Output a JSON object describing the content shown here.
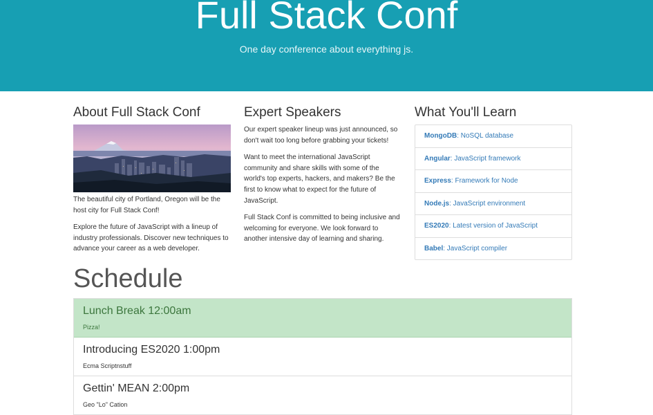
{
  "hero": {
    "title": "Full Stack Conf",
    "subtitle": "One day conference about everything js."
  },
  "about": {
    "heading": "About Full Stack Conf",
    "image_caption": "The beautiful city of Portland, Oregon will be the host city for Full Stack Conf!",
    "paragraph": "Explore the future of JavaScript with a lineup of industry professionals. Discover new techniques to advance your career as a web developer."
  },
  "speakers": {
    "heading": "Expert Speakers",
    "paragraphs": [
      "Our expert speaker lineup was just announced, so don't wait too long before grabbing your tickets!",
      "Want to meet the international JavaScript community and share skills with some of the world's top experts, hackers, and makers? Be the first to know what to expect for the future of JavaScript.",
      "Full Stack Conf is committed to being inclusive and welcoming for everyone. We look forward to another intensive day of learning and sharing."
    ]
  },
  "learn": {
    "heading": "What You'll Learn",
    "items": [
      {
        "name": "MongoDB",
        "desc": ": NoSQL database"
      },
      {
        "name": "Angular",
        "desc": ": JavaScript framework"
      },
      {
        "name": "Express",
        "desc": ": Framework for Node"
      },
      {
        "name": "Node.js",
        "desc": ": JavaScript environment"
      },
      {
        "name": "ES2020",
        "desc": ": Latest version of JavaScript"
      },
      {
        "name": "Babel",
        "desc": ": JavaScript compiler"
      }
    ]
  },
  "schedule": {
    "heading": "Schedule",
    "items": [
      {
        "title": "Lunch Break 12:00am",
        "desc": "Pizza!"
      },
      {
        "title": "Introducing ES2020 1:00pm",
        "desc": "Ecma Scriptnstuff"
      },
      {
        "title": "Gettin' MEAN 2:00pm",
        "desc": "Geo \"Lo\" Cation"
      }
    ]
  },
  "colors": {
    "hero_bg": "#179fb3",
    "link": "#337ab7",
    "highlight_bg": "#c3e5c8"
  }
}
